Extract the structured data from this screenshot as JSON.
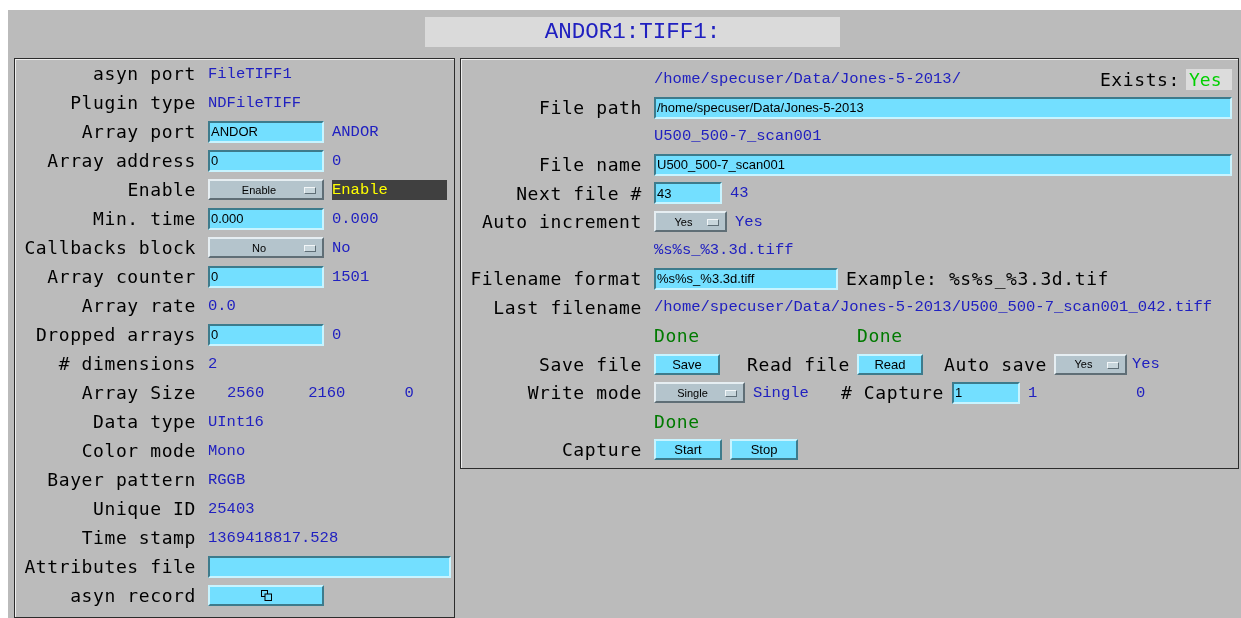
{
  "title": "ANDOR1:TIFF1:",
  "left_rows": [
    {
      "kind": "text",
      "label": "asyn port",
      "value": "FileTIFF1"
    },
    {
      "kind": "text",
      "label": "Plugin type",
      "value": "NDFileTIFF"
    },
    {
      "kind": "field",
      "label": "Array port",
      "value": "ANDOR",
      "readback": "ANDOR",
      "alarm": false
    },
    {
      "kind": "field",
      "label": "Array address",
      "value": "0",
      "readback": "0",
      "alarm": false
    },
    {
      "kind": "menu",
      "label": "Enable",
      "value": "Enable",
      "readback": "Enable",
      "alarm": true
    },
    {
      "kind": "field",
      "label": "Min. time",
      "value": "0.000",
      "readback": "0.000",
      "alarm": false
    },
    {
      "kind": "menu",
      "label": "Callbacks block",
      "value": "No",
      "readback": "No",
      "alarm": false
    },
    {
      "kind": "field",
      "label": "Array counter",
      "value": "0",
      "readback": "1501",
      "alarm": false
    },
    {
      "kind": "text",
      "label": "Array rate",
      "value": "0.0"
    },
    {
      "kind": "field",
      "label": "Dropped arrays",
      "value": "0",
      "readback": "0",
      "alarm": false
    },
    {
      "kind": "text",
      "label": "# dimensions",
      "value": "2"
    },
    {
      "kind": "multi",
      "label": "Array Size",
      "values": [
        "2560",
        "2160",
        "0"
      ]
    },
    {
      "kind": "text",
      "label": "Data type",
      "value": "UInt16"
    },
    {
      "kind": "text",
      "label": "Color mode",
      "value": "Mono"
    },
    {
      "kind": "text",
      "label": "Bayer pattern",
      "value": "RGGB"
    },
    {
      "kind": "text",
      "label": "Unique ID",
      "value": "25403"
    },
    {
      "kind": "text",
      "label": "Time stamp",
      "value": "1369418817.528"
    },
    {
      "kind": "wide_field",
      "label": "Attributes file"
    },
    {
      "kind": "button",
      "label": "asyn record"
    }
  ],
  "right": {
    "path": {
      "readback": "/home/specuser/Data/Jones-5-2013/",
      "label": "File path",
      "value": "/home/specuser/Data/Jones-5-2013"
    },
    "exists": {
      "label": "Exists:",
      "value": "Yes"
    },
    "name": {
      "readback": "U500_500-7_scan001",
      "label": "File name",
      "value": "U500_500-7_scan001"
    },
    "next": {
      "label": "Next file #",
      "value": "43",
      "readback": "43"
    },
    "auto_increment": {
      "label": "Auto increment",
      "value": "Yes",
      "readback": "Yes"
    },
    "format": {
      "readback": "%s%s_%3.3d.tiff",
      "label": "Filename format",
      "value": "%s%s_%3.3d.tiff",
      "example": "Example: %s%s_%3.3d.tif"
    },
    "last": {
      "label": "Last filename",
      "value": "/home/specuser/Data/Jones-5-2013/U500_500-7_scan001_042.tiff"
    },
    "save": {
      "status": "Done",
      "label": "Save file",
      "button": "Save"
    },
    "read": {
      "status": "Done",
      "label": "Read file",
      "button": "Read"
    },
    "auto_save": {
      "label": "Auto save",
      "value": "Yes",
      "readback": "Yes"
    },
    "write_mode": {
      "label": "Write mode",
      "value": "Single",
      "readback": "Single"
    },
    "num_capture": {
      "label": "# Capture",
      "value": "1",
      "readback": "1",
      "captured": "0"
    },
    "capture": {
      "status": "Done",
      "label": "Capture",
      "buttons": [
        "Start",
        "Stop"
      ]
    }
  }
}
